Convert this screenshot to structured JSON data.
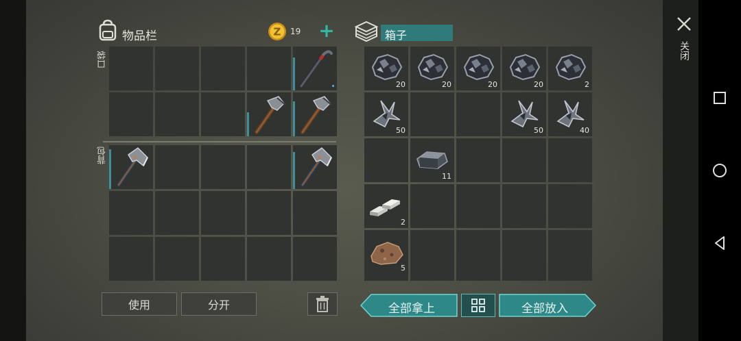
{
  "inventory": {
    "title": "物品栏",
    "pocket_label": "口袋",
    "backpack_label": "背包",
    "coins": "19",
    "add_label": "+"
  },
  "pocket_slots": [
    {
      "row": 0,
      "col": 4,
      "item": "crowbar-icon",
      "bar": 0.75
    },
    {
      "row": 1,
      "col": 3,
      "item": "hammer-icon",
      "bar": 0.55
    },
    {
      "row": 1,
      "col": 4,
      "item": "hammer-icon",
      "bar": 0.8
    }
  ],
  "backpack_slots": [
    {
      "row": 0,
      "col": 0,
      "item": "hatchet-icon",
      "bar": 0.9
    },
    {
      "row": 0,
      "col": 4,
      "item": "hatchet-icon",
      "bar": 0.85
    }
  ],
  "box": {
    "title": "箱子",
    "slots": [
      {
        "row": 0,
        "col": 0,
        "item": "iron-ore-icon",
        "count": "20"
      },
      {
        "row": 0,
        "col": 1,
        "item": "iron-ore-icon",
        "count": "20"
      },
      {
        "row": 0,
        "col": 2,
        "item": "iron-ore-icon",
        "count": "20"
      },
      {
        "row": 0,
        "col": 3,
        "item": "iron-ore-icon",
        "count": "20"
      },
      {
        "row": 0,
        "col": 4,
        "item": "iron-ore-icon",
        "count": "2"
      },
      {
        "row": 1,
        "col": 0,
        "item": "metal-scrap-icon",
        "count": "50"
      },
      {
        "row": 1,
        "col": 3,
        "item": "metal-scrap-icon",
        "count": "50"
      },
      {
        "row": 1,
        "col": 4,
        "item": "metal-scrap-icon",
        "count": "40"
      },
      {
        "row": 2,
        "col": 1,
        "item": "iron-ingot-icon",
        "count": "11"
      },
      {
        "row": 3,
        "col": 0,
        "item": "aluminum-bars-icon",
        "count": "2"
      },
      {
        "row": 4,
        "col": 0,
        "item": "stone-icon",
        "count": "5"
      }
    ]
  },
  "buttons": {
    "use": "使用",
    "split": "分开",
    "take_all": "全部拿上",
    "put_all": "全部放入",
    "close": "关闭"
  },
  "colors": {
    "teal": "#2f8c8c",
    "slot": "#313330",
    "accent_bar": "#3e8f98",
    "coin": "#e3b22a"
  }
}
